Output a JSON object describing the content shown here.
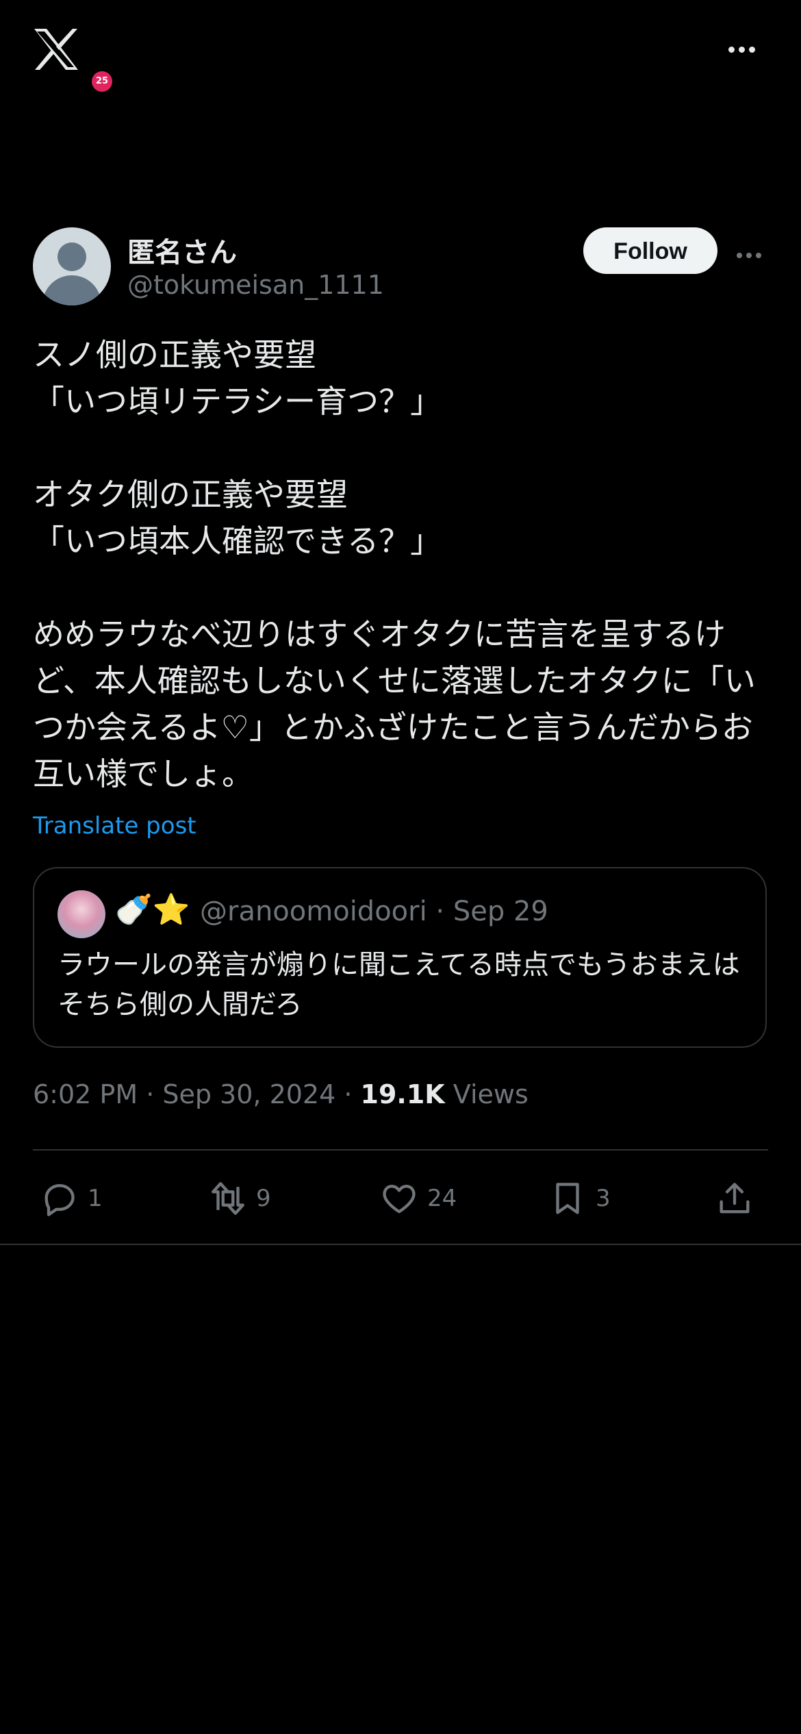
{
  "topbar": {
    "logo": "x-logo-icon",
    "badge": "25",
    "more": "more-icon"
  },
  "author": {
    "name": "匿名さん",
    "handle": "@tokumeisan_1111",
    "follow_label": "Follow"
  },
  "post": {
    "text": "スノ側の正義や要望\n「いつ頃リテラシー育つ？」\n\nオタク側の正義や要望\n「いつ頃本人確認できる？」\n\nめめラウなべ辺りはすぐオタクに苦言を呈するけど、本人確認もしないくせに落選したオタクに「いつか会えるよ♡」とかふざけたこと言うんだからお互い様でしょ。",
    "translate_label": "Translate post"
  },
  "quote": {
    "emoji": "🍼⭐",
    "handle_date": "@ranoomoidoori · Sep 29",
    "text": "ラウールの発言が煽りに聞こえてる時点でもうおまえはそちら側の人間だろ"
  },
  "meta": {
    "time_date": "6:02 PM · Sep 30, 2024 · ",
    "views_count": "19.1K",
    "views_label": " Views"
  },
  "actions": {
    "replies": "1",
    "reposts": "9",
    "likes": "24",
    "bookmarks": "3"
  },
  "colors": {
    "accent": "#1d9bf0",
    "background": "#000000",
    "muted": "#71767b"
  }
}
